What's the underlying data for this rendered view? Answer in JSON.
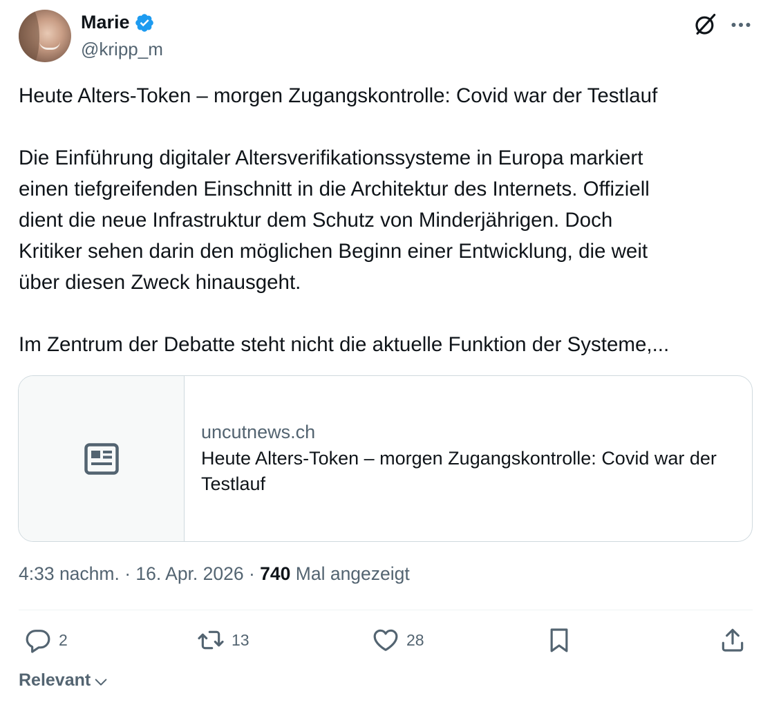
{
  "author": {
    "display_name": "Marie",
    "handle": "@kripp_m",
    "verified_color": "#1d9bf0"
  },
  "tweet": {
    "paragraphs": [
      "Heute Alters-Token – morgen Zugangskontrolle: Covid war der Testlauf",
      "",
      "Die Einführung digitaler Altersverifikationssysteme in Europa markiert",
      "einen tiefgreifenden Einschnitt in die Architektur des Internets. Offiziell",
      "dient die neue Infrastruktur dem Schutz von Minderjährigen. Doch",
      "Kritiker sehen darin den möglichen Beginn einer Entwicklung, die weit",
      "über diesen Zweck hinausgeht.",
      "",
      "Im Zentrum der Debatte steht nicht die aktuelle Funktion der Systeme,..."
    ]
  },
  "card": {
    "icon": "article-icon",
    "domain": "uncutnews.ch",
    "title": "Heute Alters-Token – morgen Zugangskontrolle: Covid war der Testlauf"
  },
  "meta": {
    "time": "4:33 nachm.",
    "separator": " · ",
    "date": "16. Apr. 2026",
    "views_count": "740",
    "views_label": "Mal angezeigt"
  },
  "actions": {
    "replies": "2",
    "retweets": "13",
    "likes": "28"
  },
  "sort": {
    "label": "Relevant"
  },
  "icons": {
    "grok": "grok-icon",
    "more": "more-icon",
    "reply": "reply-icon",
    "retweet": "retweet-icon",
    "like": "heart-icon",
    "bookmark": "bookmark-icon",
    "share": "share-icon",
    "chevron": "chevron-down-icon"
  }
}
